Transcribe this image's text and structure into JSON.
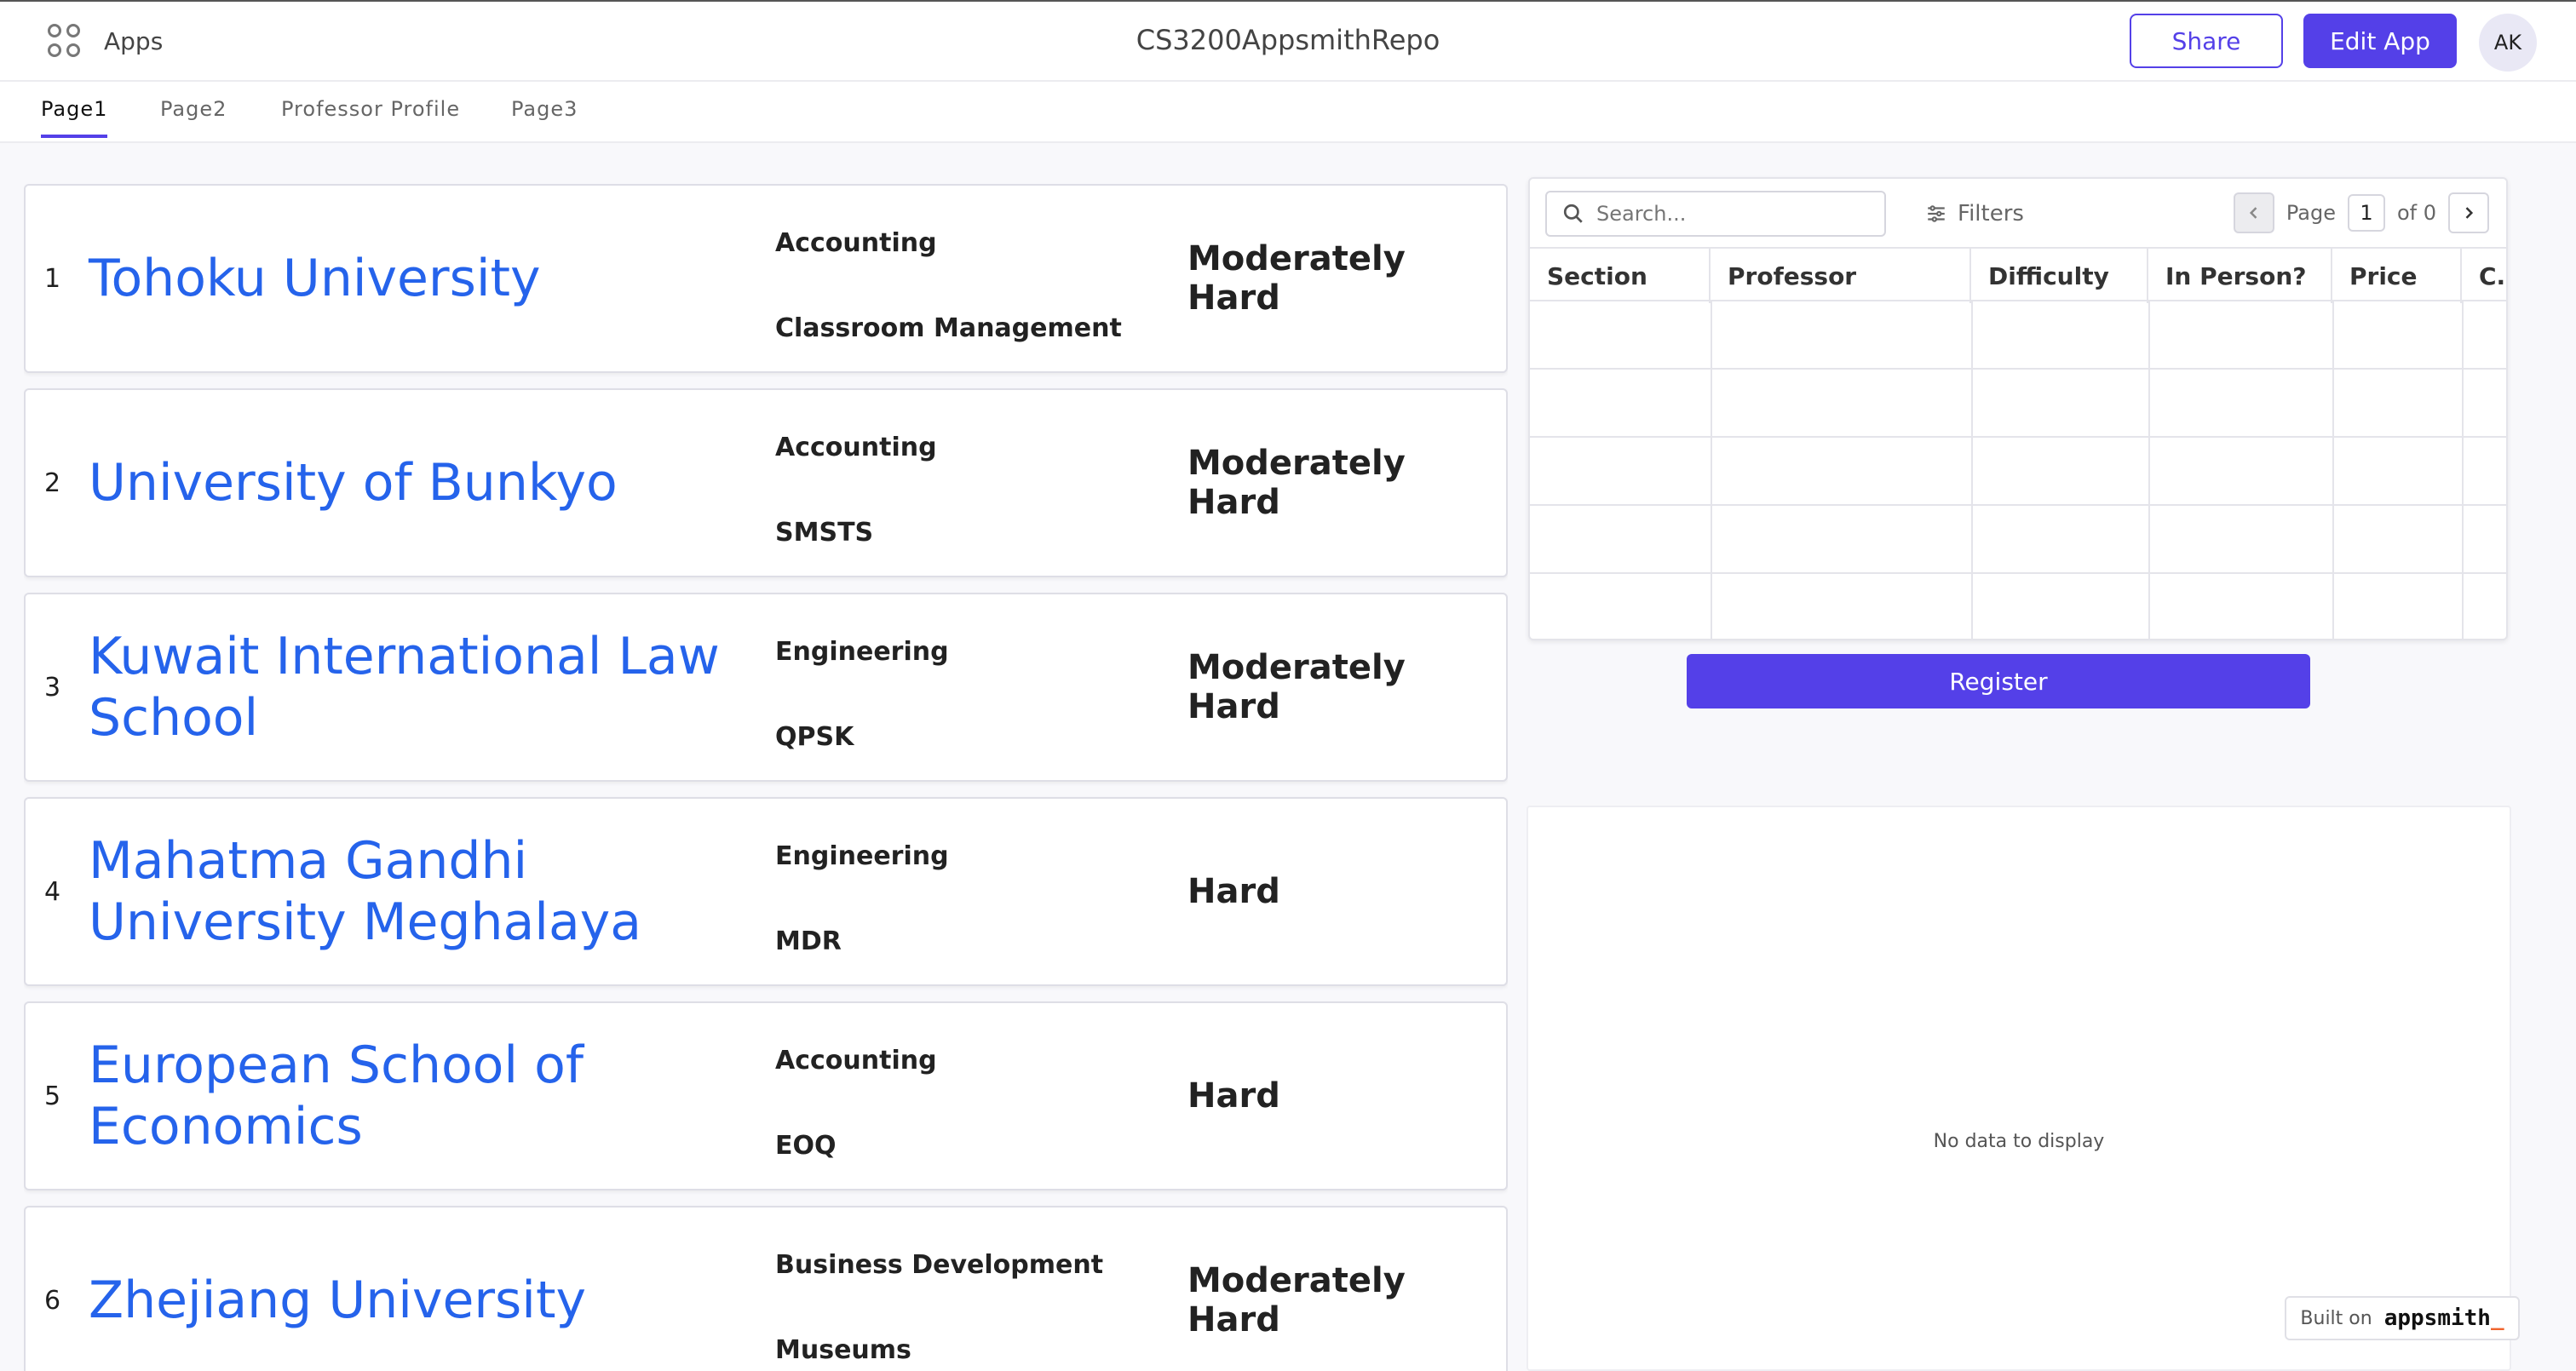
{
  "header": {
    "apps_label": "Apps",
    "title": "CS3200AppsmithRepo",
    "share_label": "Share",
    "edit_label": "Edit App",
    "avatar_initials": "AK"
  },
  "tabs": [
    {
      "label": "Page1",
      "active": true
    },
    {
      "label": "Page2",
      "active": false
    },
    {
      "label": "Professor Profile",
      "active": false
    },
    {
      "label": "Page3",
      "active": false
    }
  ],
  "list": [
    {
      "num": "1",
      "university": "Tohoku University",
      "department": "Accounting",
      "course": "Classroom Management",
      "difficulty": "Moderately Hard"
    },
    {
      "num": "2",
      "university": "University of Bunkyo",
      "department": "Accounting",
      "course": "SMSTS",
      "difficulty": "Moderately Hard"
    },
    {
      "num": "3",
      "university": "Kuwait International Law School",
      "department": "Engineering",
      "course": "QPSK",
      "difficulty": "Moderately Hard"
    },
    {
      "num": "4",
      "university": "Mahatma Gandhi University Meghalaya",
      "department": "Engineering",
      "course": "MDR",
      "difficulty": "Hard"
    },
    {
      "num": "5",
      "university": "European School of Economics",
      "department": "Accounting",
      "course": "EOQ",
      "difficulty": "Hard"
    },
    {
      "num": "6",
      "university": "Zhejiang University",
      "department": "Business Development",
      "course": "Museums",
      "difficulty": "Moderately Hard"
    }
  ],
  "table": {
    "search_placeholder": "Search...",
    "filters_label": "Filters",
    "page_label": "Page",
    "page_number": "1",
    "page_of": "of 0",
    "columns": [
      "Section",
      "Professor",
      "Difficulty",
      "In Person?",
      "Price",
      "C..."
    ]
  },
  "register_label": "Register",
  "chart": {
    "empty_text": "No data to display"
  },
  "footer": {
    "built_on": "Built on",
    "brand": "appsmith",
    "brand_suffix": "_"
  },
  "colors": {
    "accent": "#5440e8",
    "link": "#2563eb"
  }
}
